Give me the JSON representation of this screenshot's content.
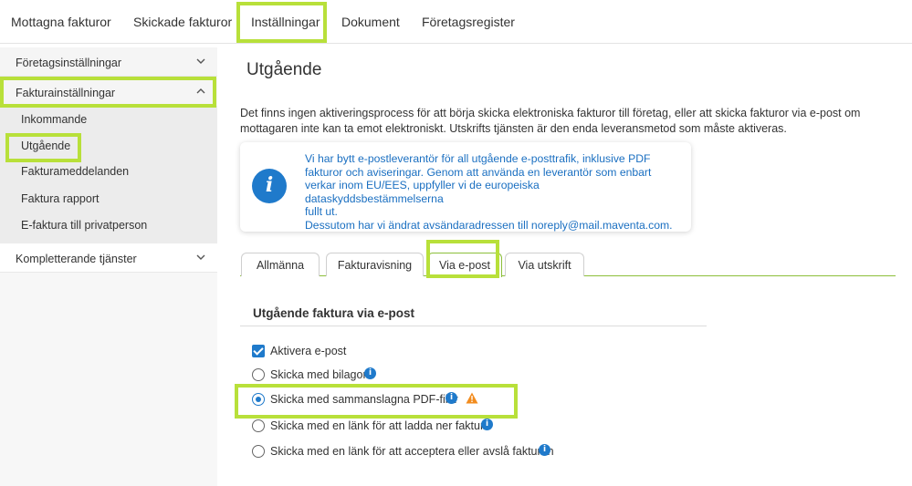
{
  "topnav": {
    "items": [
      "Mottagna fakturor",
      "Skickade fakturor",
      "Inställningar",
      "Dokument",
      "Företagsregister"
    ]
  },
  "sidebar": {
    "sections": [
      {
        "label": "Företagsinställningar",
        "expanded": false
      },
      {
        "label": "Fakturainställningar",
        "expanded": true
      },
      {
        "label": "Kompletterande tjänster",
        "expanded": false
      }
    ],
    "subitems": [
      "Inkommande",
      "Utgående",
      "Fakturameddelanden",
      "Faktura rapport",
      "E-faktura till privatperson"
    ]
  },
  "main": {
    "title": "Utgående",
    "intro": "Det finns ingen aktiveringsprocess för att börja skicka elektroniska fakturor till företag, eller att skicka fakturor via e-post om mottagaren inte kan ta emot elektroniskt. Utskrifts tjänsten är den enda leveransmetod som måste aktiveras.",
    "info_lines": [
      "Vi har bytt e-postleverantör för all utgående e-posttrafik, inklusive PDF",
      "fakturor och aviseringar. Genom att använda en leverantör som enbart",
      "verkar inom EU/EES, uppfyller vi de europeiska dataskyddsbestämmelserna",
      "fullt ut.",
      "Dessutom har vi ändrat avsändaradressen till noreply@mail.maventa.com."
    ],
    "tabs": [
      "Allmänna",
      "Fakturavisning",
      "Via e-post",
      "Via utskrift"
    ],
    "active_tab": "Via e-post",
    "section_title": "Utgående faktura via e-post",
    "options": {
      "activate": {
        "label": "Aktivera e-post",
        "checked": true
      },
      "radio1": {
        "label": "Skicka med bilagor",
        "selected": false
      },
      "radio2": {
        "label": "Skicka med sammanslagna PDF-filer",
        "selected": true
      },
      "radio3": {
        "label": "Skicka med en länk för att ladda ner faktura",
        "selected": false
      },
      "radio4": {
        "label": "Skicka med en länk för att acceptera eller avslå fakturan",
        "selected": false
      }
    },
    "info_icon_glyph": "i"
  },
  "colors": {
    "highlight": "#b8e03a",
    "accent_blue": "#1f7acb",
    "tab_green": "#8cbf3a",
    "warning": "#f28c1e"
  }
}
